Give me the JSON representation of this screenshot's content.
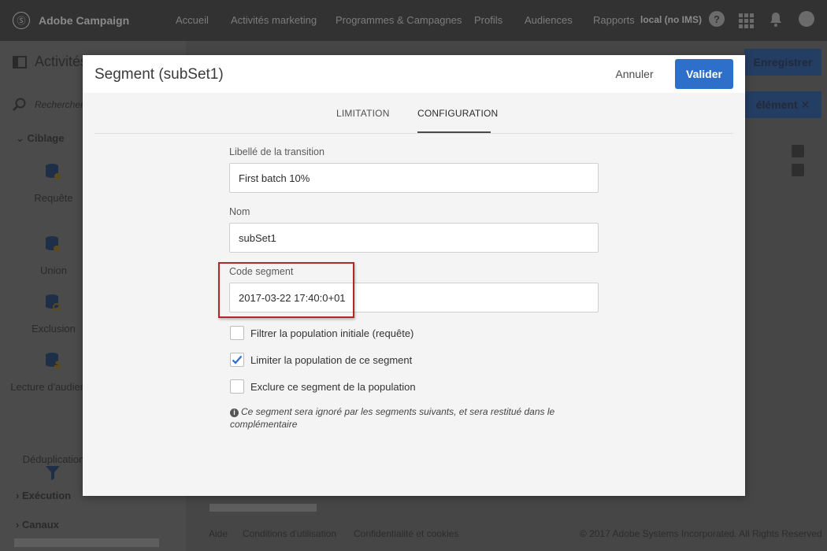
{
  "app": {
    "name": "Adobe Campaign",
    "logo_glyph": "Ⓢ",
    "nav": [
      "Accueil",
      "Activités marketing",
      "Programmes & Campagnes",
      "Profils",
      "Audiences",
      "Rapports"
    ],
    "instance": "local (no IMS)"
  },
  "background": {
    "page_title": "Activités",
    "search_placeholder": "Rechercher...",
    "save_button": "Enregistrer",
    "element_button": "élément",
    "sections": {
      "ciblage": "Ciblage",
      "execution": "Exécution",
      "canaux": "Canaux"
    },
    "activities": [
      {
        "label": "Requête",
        "icon": "database-query-icon"
      },
      {
        "label": "Union",
        "icon": "database-union-icon"
      },
      {
        "label": "Exclusion",
        "icon": "database-exclusion-icon"
      },
      {
        "label": "Lecture d'audience",
        "icon": "database-audience-icon"
      },
      {
        "label": "Déduplication",
        "icon": "funnel-icon"
      }
    ],
    "footer": {
      "aide": "Aide",
      "conditions": "Conditions d'utilisation",
      "confidentialite": "Confidentialité et cookies",
      "copyright": "© 2017 Adobe Systems Incorporated. All Rights Reserved"
    }
  },
  "dialog": {
    "title": "Segment (subSet1)",
    "cancel_label": "Annuler",
    "ok_label": "Valider",
    "tabs": [
      {
        "label": "LIMITATION",
        "active": false
      },
      {
        "label": "CONFIGURATION",
        "active": true
      }
    ],
    "fields": {
      "transition_label": {
        "label": "Libellé de la transition",
        "value": "First batch 10%"
      },
      "name": {
        "label": "Nom",
        "value": "subSet1"
      },
      "segment_code": {
        "label": "Code segment",
        "value": "2017-03-22 17:40:0+01"
      }
    },
    "options": [
      {
        "label": "Filtrer la population initiale (requête)",
        "checked": false
      },
      {
        "label": "Limiter la population de ce segment",
        "checked": true
      },
      {
        "label": "Exclure ce segment de la population",
        "checked": false
      }
    ],
    "note": "Ce segment sera ignoré par les segments suivants, et sera restitué dans le complémentaire"
  },
  "colors": {
    "primary": "#2d6fc9",
    "highlight": "#b5262a",
    "topbar": "#323232"
  }
}
